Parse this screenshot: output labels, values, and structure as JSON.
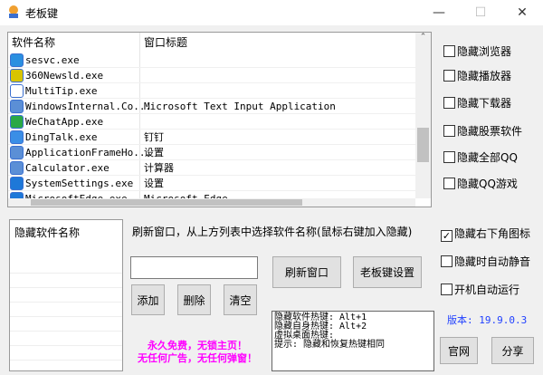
{
  "window": {
    "title": "老板键",
    "minimize": "—",
    "maximize": "☐",
    "close": "✕"
  },
  "process_list": {
    "headers": [
      "软件名称",
      "窗口标题"
    ],
    "rows": [
      {
        "name": "sesvc.exe",
        "title": "",
        "color": "#2a8fe0"
      },
      {
        "name": "360Newsld.exe",
        "title": "",
        "color": "#d8c400"
      },
      {
        "name": "MultiTip.exe",
        "title": "",
        "color": "#ffffff"
      },
      {
        "name": "WindowsInternal.Co...",
        "title": "Microsoft Text Input Application",
        "color": "#5b8fd6"
      },
      {
        "name": "WeChatApp.exe",
        "title": "",
        "color": "#2aa845"
      },
      {
        "name": "DingTalk.exe",
        "title": "钉钉",
        "color": "#3a8ee6"
      },
      {
        "name": "ApplicationFrameHo...",
        "title": "设置",
        "color": "#5b8fd6"
      },
      {
        "name": "Calculator.exe",
        "title": "计算器",
        "color": "#5b8fd6"
      },
      {
        "name": "SystemSettings.exe",
        "title": "设置",
        "color": "#1e78d8"
      },
      {
        "name": "MicrosoftEdge.exe",
        "title": "Microsoft Edge",
        "color": "#1e78d8"
      }
    ]
  },
  "right_options": [
    {
      "label": "隐藏浏览器",
      "checked": false
    },
    {
      "label": "隐藏播放器",
      "checked": false
    },
    {
      "label": "隐藏下载器",
      "checked": false
    },
    {
      "label": "隐藏股票软件",
      "checked": false
    },
    {
      "label": "隐藏全部QQ",
      "checked": false
    },
    {
      "label": "隐藏QQ游戏",
      "checked": false
    }
  ],
  "hidden_list": {
    "header": "隐藏软件名称"
  },
  "instruction": "刷新窗口，从上方列表中选择软件名称(鼠标右键加入隐藏)",
  "name_input": {
    "value": ""
  },
  "buttons": {
    "add": "添加",
    "delete": "删除",
    "clear": "清空",
    "refresh": "刷新窗口",
    "settings": "老板键设置",
    "website": "官网",
    "share": "分享"
  },
  "info_lines": [
    "隐藏软件热键: Alt+1",
    "隐藏自身热键: Alt+2",
    "虚拟桌面热键:",
    "提示: 隐藏和恢复热键相同"
  ],
  "promo": [
    "永久免费，无锁主页！",
    "无任何广告，无任何弹窗！"
  ],
  "bottom_options": [
    {
      "label": "隐藏右下角图标",
      "checked": true
    },
    {
      "label": "隐藏时自动静音",
      "checked": false
    },
    {
      "label": "开机自动运行",
      "checked": false
    }
  ],
  "version": "版本: 19.9.0.3"
}
